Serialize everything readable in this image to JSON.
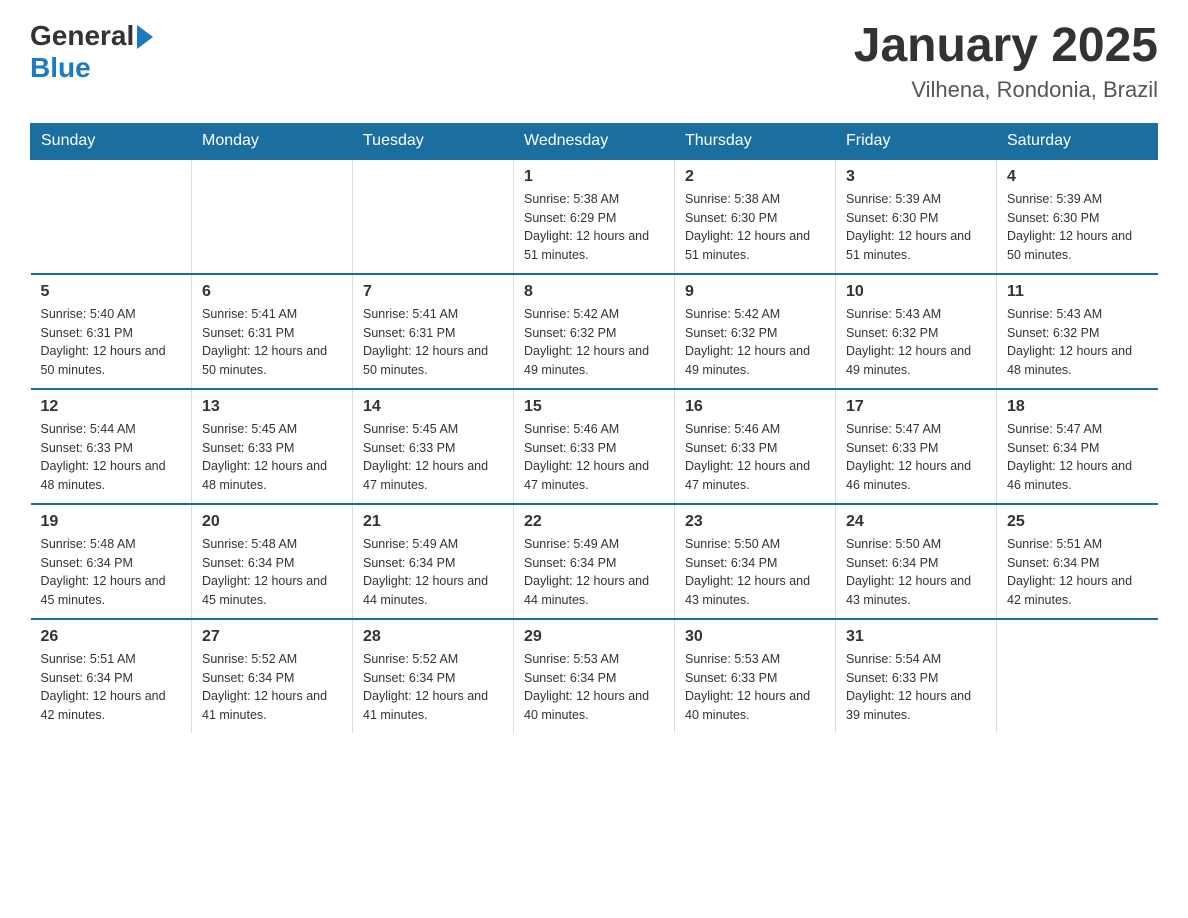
{
  "header": {
    "logo_general": "General",
    "logo_blue": "Blue",
    "title": "January 2025",
    "subtitle": "Vilhena, Rondonia, Brazil"
  },
  "days_of_week": [
    "Sunday",
    "Monday",
    "Tuesday",
    "Wednesday",
    "Thursday",
    "Friday",
    "Saturday"
  ],
  "weeks": [
    [
      {
        "day": "",
        "info": ""
      },
      {
        "day": "",
        "info": ""
      },
      {
        "day": "",
        "info": ""
      },
      {
        "day": "1",
        "info": "Sunrise: 5:38 AM\nSunset: 6:29 PM\nDaylight: 12 hours and 51 minutes."
      },
      {
        "day": "2",
        "info": "Sunrise: 5:38 AM\nSunset: 6:30 PM\nDaylight: 12 hours and 51 minutes."
      },
      {
        "day": "3",
        "info": "Sunrise: 5:39 AM\nSunset: 6:30 PM\nDaylight: 12 hours and 51 minutes."
      },
      {
        "day": "4",
        "info": "Sunrise: 5:39 AM\nSunset: 6:30 PM\nDaylight: 12 hours and 50 minutes."
      }
    ],
    [
      {
        "day": "5",
        "info": "Sunrise: 5:40 AM\nSunset: 6:31 PM\nDaylight: 12 hours and 50 minutes."
      },
      {
        "day": "6",
        "info": "Sunrise: 5:41 AM\nSunset: 6:31 PM\nDaylight: 12 hours and 50 minutes."
      },
      {
        "day": "7",
        "info": "Sunrise: 5:41 AM\nSunset: 6:31 PM\nDaylight: 12 hours and 50 minutes."
      },
      {
        "day": "8",
        "info": "Sunrise: 5:42 AM\nSunset: 6:32 PM\nDaylight: 12 hours and 49 minutes."
      },
      {
        "day": "9",
        "info": "Sunrise: 5:42 AM\nSunset: 6:32 PM\nDaylight: 12 hours and 49 minutes."
      },
      {
        "day": "10",
        "info": "Sunrise: 5:43 AM\nSunset: 6:32 PM\nDaylight: 12 hours and 49 minutes."
      },
      {
        "day": "11",
        "info": "Sunrise: 5:43 AM\nSunset: 6:32 PM\nDaylight: 12 hours and 48 minutes."
      }
    ],
    [
      {
        "day": "12",
        "info": "Sunrise: 5:44 AM\nSunset: 6:33 PM\nDaylight: 12 hours and 48 minutes."
      },
      {
        "day": "13",
        "info": "Sunrise: 5:45 AM\nSunset: 6:33 PM\nDaylight: 12 hours and 48 minutes."
      },
      {
        "day": "14",
        "info": "Sunrise: 5:45 AM\nSunset: 6:33 PM\nDaylight: 12 hours and 47 minutes."
      },
      {
        "day": "15",
        "info": "Sunrise: 5:46 AM\nSunset: 6:33 PM\nDaylight: 12 hours and 47 minutes."
      },
      {
        "day": "16",
        "info": "Sunrise: 5:46 AM\nSunset: 6:33 PM\nDaylight: 12 hours and 47 minutes."
      },
      {
        "day": "17",
        "info": "Sunrise: 5:47 AM\nSunset: 6:33 PM\nDaylight: 12 hours and 46 minutes."
      },
      {
        "day": "18",
        "info": "Sunrise: 5:47 AM\nSunset: 6:34 PM\nDaylight: 12 hours and 46 minutes."
      }
    ],
    [
      {
        "day": "19",
        "info": "Sunrise: 5:48 AM\nSunset: 6:34 PM\nDaylight: 12 hours and 45 minutes."
      },
      {
        "day": "20",
        "info": "Sunrise: 5:48 AM\nSunset: 6:34 PM\nDaylight: 12 hours and 45 minutes."
      },
      {
        "day": "21",
        "info": "Sunrise: 5:49 AM\nSunset: 6:34 PM\nDaylight: 12 hours and 44 minutes."
      },
      {
        "day": "22",
        "info": "Sunrise: 5:49 AM\nSunset: 6:34 PM\nDaylight: 12 hours and 44 minutes."
      },
      {
        "day": "23",
        "info": "Sunrise: 5:50 AM\nSunset: 6:34 PM\nDaylight: 12 hours and 43 minutes."
      },
      {
        "day": "24",
        "info": "Sunrise: 5:50 AM\nSunset: 6:34 PM\nDaylight: 12 hours and 43 minutes."
      },
      {
        "day": "25",
        "info": "Sunrise: 5:51 AM\nSunset: 6:34 PM\nDaylight: 12 hours and 42 minutes."
      }
    ],
    [
      {
        "day": "26",
        "info": "Sunrise: 5:51 AM\nSunset: 6:34 PM\nDaylight: 12 hours and 42 minutes."
      },
      {
        "day": "27",
        "info": "Sunrise: 5:52 AM\nSunset: 6:34 PM\nDaylight: 12 hours and 41 minutes."
      },
      {
        "day": "28",
        "info": "Sunrise: 5:52 AM\nSunset: 6:34 PM\nDaylight: 12 hours and 41 minutes."
      },
      {
        "day": "29",
        "info": "Sunrise: 5:53 AM\nSunset: 6:34 PM\nDaylight: 12 hours and 40 minutes."
      },
      {
        "day": "30",
        "info": "Sunrise: 5:53 AM\nSunset: 6:33 PM\nDaylight: 12 hours and 40 minutes."
      },
      {
        "day": "31",
        "info": "Sunrise: 5:54 AM\nSunset: 6:33 PM\nDaylight: 12 hours and 39 minutes."
      },
      {
        "day": "",
        "info": ""
      }
    ]
  ]
}
